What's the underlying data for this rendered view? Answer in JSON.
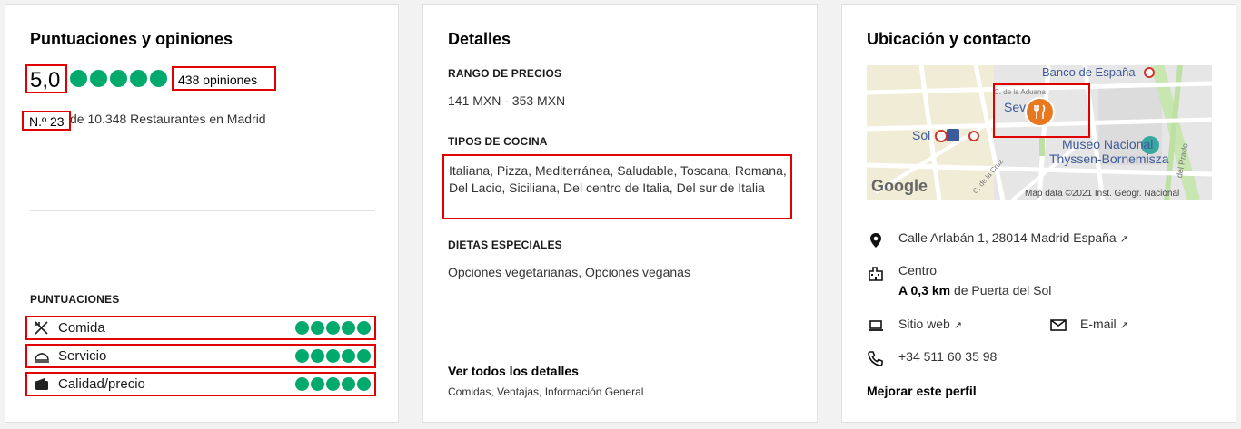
{
  "ratings": {
    "title": "Puntuaciones y opiniones",
    "score": "5,0",
    "review_count": "438 opiniones",
    "rank_prefix": "N.º 23",
    "rank_suffix": "de 10.348 Restaurantes en Madrid",
    "section_title": "PUNTUACIONES",
    "rows": [
      {
        "label": "Comida"
      },
      {
        "label": "Servicio"
      },
      {
        "label": "Calidad/precio"
      }
    ]
  },
  "details": {
    "title": "Detalles",
    "price_range_title": "RANGO DE PRECIOS",
    "price_range": "141 MXN - 353 MXN",
    "cuisine_title": "TIPOS DE COCINA",
    "cuisine": "Italiana, Pizza, Mediterránea, Saludable, Toscana, Romana, Del Lacio, Siciliana, Del centro de Italia, Del sur de Italia",
    "diet_title": "DIETAS ESPECIALES",
    "diet": "Opciones vegetarianas, Opciones veganas",
    "all_details_link": "Ver todos los detalles",
    "all_details_sub": "Comidas, Ventajas, Información General"
  },
  "location": {
    "title": "Ubicación y contacto",
    "map": {
      "labels": {
        "banco": "Banco de España",
        "sev": "Sev",
        "sol": "Sol",
        "museo1": "Museo Nacional",
        "museo2": "Thyssen-Bornemisza",
        "street1": "C. de la Aduana",
        "street2": "C. de la Cruz",
        "street3": "del Prado",
        "google": "Google",
        "attribution": "Map data ©2021 Inst. Geogr. Nacional"
      }
    },
    "address": "Calle Arlabán 1, 28014 Madrid España",
    "neighborhood": "Centro",
    "distance_value": "A 0,3 km",
    "distance_suffix": "de Puerta del Sol",
    "website": "Sitio web",
    "email": "E-mail",
    "phone": "+34 511 60 35 98",
    "improve": "Mejorar este perfil"
  },
  "colors": {
    "rating_green": "#00aa6c",
    "highlight_red": "#e00000",
    "pin_orange": "#e8781f"
  }
}
